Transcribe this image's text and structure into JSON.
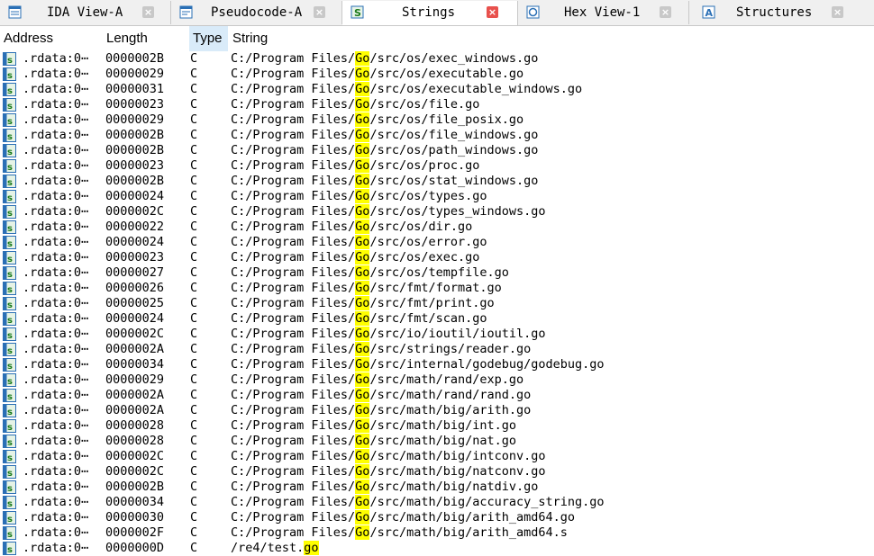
{
  "tabs": [
    {
      "label": "IDA View-A",
      "icon": "ida-view-icon",
      "active": false
    },
    {
      "label": "Pseudocode-A",
      "icon": "pseudocode-icon",
      "active": false
    },
    {
      "label": "Strings",
      "icon": "strings-icon",
      "active": true
    },
    {
      "label": "Hex View-1",
      "icon": "hex-view-icon",
      "active": false
    },
    {
      "label": "Structures",
      "icon": "structures-icon",
      "active": false
    }
  ],
  "close_glyph": "×",
  "columns": {
    "address": "Address",
    "length": "Length",
    "type": "Type",
    "string": "String"
  },
  "highlight": {
    "term": "Go",
    "color": "#ffff00"
  },
  "rows": [
    {
      "address": ".rdata:0⋯",
      "length": "0000002B",
      "type": "C",
      "pre": "C:/Program Files/",
      "hl": "Go",
      "post": "/src/os/exec_windows.go"
    },
    {
      "address": ".rdata:0⋯",
      "length": "00000029",
      "type": "C",
      "pre": "C:/Program Files/",
      "hl": "Go",
      "post": "/src/os/executable.go"
    },
    {
      "address": ".rdata:0⋯",
      "length": "00000031",
      "type": "C",
      "pre": "C:/Program Files/",
      "hl": "Go",
      "post": "/src/os/executable_windows.go"
    },
    {
      "address": ".rdata:0⋯",
      "length": "00000023",
      "type": "C",
      "pre": "C:/Program Files/",
      "hl": "Go",
      "post": "/src/os/file.go"
    },
    {
      "address": ".rdata:0⋯",
      "length": "00000029",
      "type": "C",
      "pre": "C:/Program Files/",
      "hl": "Go",
      "post": "/src/os/file_posix.go"
    },
    {
      "address": ".rdata:0⋯",
      "length": "0000002B",
      "type": "C",
      "pre": "C:/Program Files/",
      "hl": "Go",
      "post": "/src/os/file_windows.go"
    },
    {
      "address": ".rdata:0⋯",
      "length": "0000002B",
      "type": "C",
      "pre": "C:/Program Files/",
      "hl": "Go",
      "post": "/src/os/path_windows.go"
    },
    {
      "address": ".rdata:0⋯",
      "length": "00000023",
      "type": "C",
      "pre": "C:/Program Files/",
      "hl": "Go",
      "post": "/src/os/proc.go"
    },
    {
      "address": ".rdata:0⋯",
      "length": "0000002B",
      "type": "C",
      "pre": "C:/Program Files/",
      "hl": "Go",
      "post": "/src/os/stat_windows.go"
    },
    {
      "address": ".rdata:0⋯",
      "length": "00000024",
      "type": "C",
      "pre": "C:/Program Files/",
      "hl": "Go",
      "post": "/src/os/types.go"
    },
    {
      "address": ".rdata:0⋯",
      "length": "0000002C",
      "type": "C",
      "pre": "C:/Program Files/",
      "hl": "Go",
      "post": "/src/os/types_windows.go"
    },
    {
      "address": ".rdata:0⋯",
      "length": "00000022",
      "type": "C",
      "pre": "C:/Program Files/",
      "hl": "Go",
      "post": "/src/os/dir.go"
    },
    {
      "address": ".rdata:0⋯",
      "length": "00000024",
      "type": "C",
      "pre": "C:/Program Files/",
      "hl": "Go",
      "post": "/src/os/error.go"
    },
    {
      "address": ".rdata:0⋯",
      "length": "00000023",
      "type": "C",
      "pre": "C:/Program Files/",
      "hl": "Go",
      "post": "/src/os/exec.go"
    },
    {
      "address": ".rdata:0⋯",
      "length": "00000027",
      "type": "C",
      "pre": "C:/Program Files/",
      "hl": "Go",
      "post": "/src/os/tempfile.go"
    },
    {
      "address": ".rdata:0⋯",
      "length": "00000026",
      "type": "C",
      "pre": "C:/Program Files/",
      "hl": "Go",
      "post": "/src/fmt/format.go"
    },
    {
      "address": ".rdata:0⋯",
      "length": "00000025",
      "type": "C",
      "pre": "C:/Program Files/",
      "hl": "Go",
      "post": "/src/fmt/print.go"
    },
    {
      "address": ".rdata:0⋯",
      "length": "00000024",
      "type": "C",
      "pre": "C:/Program Files/",
      "hl": "Go",
      "post": "/src/fmt/scan.go"
    },
    {
      "address": ".rdata:0⋯",
      "length": "0000002C",
      "type": "C",
      "pre": "C:/Program Files/",
      "hl": "Go",
      "post": "/src/io/ioutil/ioutil.go"
    },
    {
      "address": ".rdata:0⋯",
      "length": "0000002A",
      "type": "C",
      "pre": "C:/Program Files/",
      "hl": "Go",
      "post": "/src/strings/reader.go"
    },
    {
      "address": ".rdata:0⋯",
      "length": "00000034",
      "type": "C",
      "pre": "C:/Program Files/",
      "hl": "Go",
      "post": "/src/internal/godebug/godebug.go"
    },
    {
      "address": ".rdata:0⋯",
      "length": "00000029",
      "type": "C",
      "pre": "C:/Program Files/",
      "hl": "Go",
      "post": "/src/math/rand/exp.go"
    },
    {
      "address": ".rdata:0⋯",
      "length": "0000002A",
      "type": "C",
      "pre": "C:/Program Files/",
      "hl": "Go",
      "post": "/src/math/rand/rand.go"
    },
    {
      "address": ".rdata:0⋯",
      "length": "0000002A",
      "type": "C",
      "pre": "C:/Program Files/",
      "hl": "Go",
      "post": "/src/math/big/arith.go"
    },
    {
      "address": ".rdata:0⋯",
      "length": "00000028",
      "type": "C",
      "pre": "C:/Program Files/",
      "hl": "Go",
      "post": "/src/math/big/int.go"
    },
    {
      "address": ".rdata:0⋯",
      "length": "00000028",
      "type": "C",
      "pre": "C:/Program Files/",
      "hl": "Go",
      "post": "/src/math/big/nat.go"
    },
    {
      "address": ".rdata:0⋯",
      "length": "0000002C",
      "type": "C",
      "pre": "C:/Program Files/",
      "hl": "Go",
      "post": "/src/math/big/intconv.go"
    },
    {
      "address": ".rdata:0⋯",
      "length": "0000002C",
      "type": "C",
      "pre": "C:/Program Files/",
      "hl": "Go",
      "post": "/src/math/big/natconv.go"
    },
    {
      "address": ".rdata:0⋯",
      "length": "0000002B",
      "type": "C",
      "pre": "C:/Program Files/",
      "hl": "Go",
      "post": "/src/math/big/natdiv.go"
    },
    {
      "address": ".rdata:0⋯",
      "length": "00000034",
      "type": "C",
      "pre": "C:/Program Files/",
      "hl": "Go",
      "post": "/src/math/big/accuracy_string.go"
    },
    {
      "address": ".rdata:0⋯",
      "length": "00000030",
      "type": "C",
      "pre": "C:/Program Files/",
      "hl": "Go",
      "post": "/src/math/big/arith_amd64.go"
    },
    {
      "address": ".rdata:0⋯",
      "length": "0000002F",
      "type": "C",
      "pre": "C:/Program Files/",
      "hl": "Go",
      "post": "/src/math/big/arith_amd64.s"
    },
    {
      "address": ".rdata:0⋯",
      "length": "0000000D",
      "type": "C",
      "pre": "/re4/test.",
      "hl": "go",
      "post": ""
    }
  ]
}
